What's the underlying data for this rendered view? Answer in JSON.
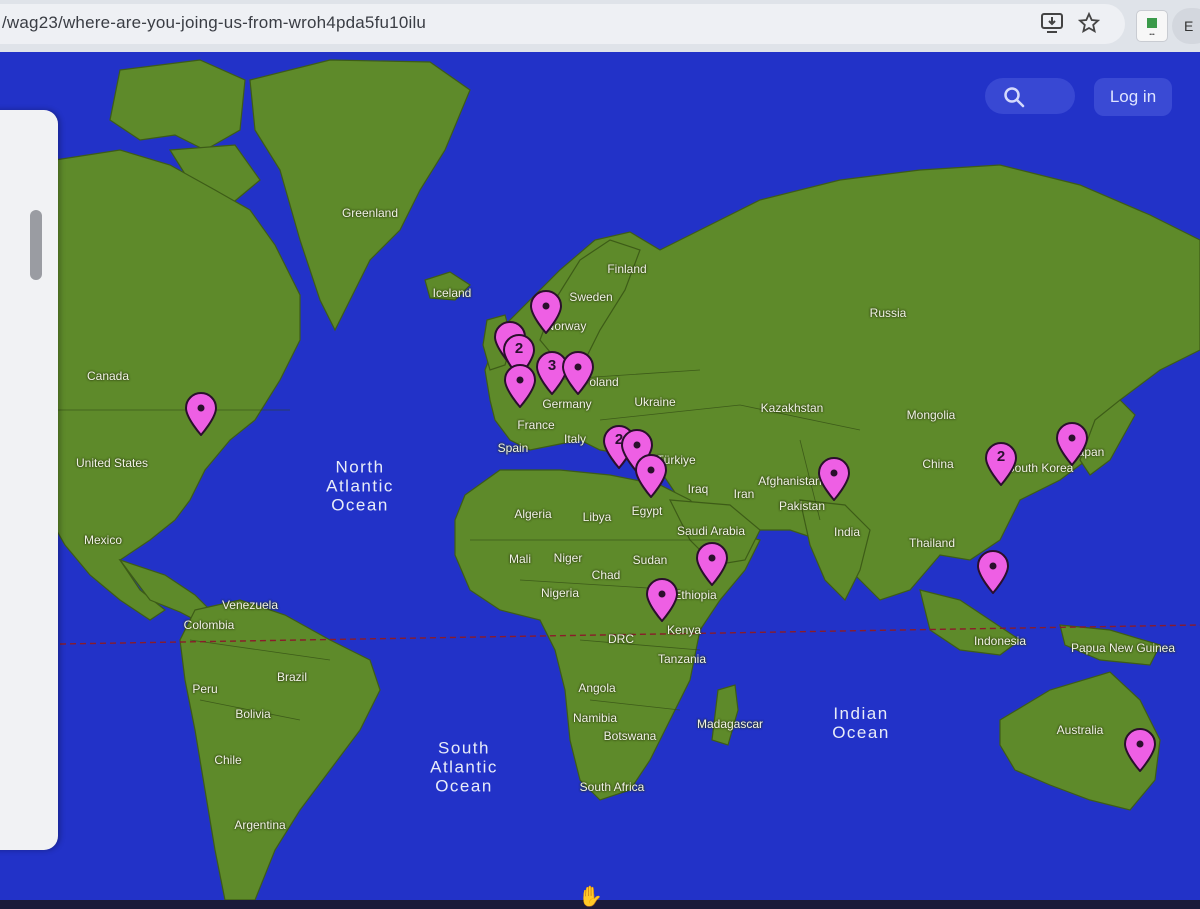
{
  "browser": {
    "url": "/wag23/where-are-you-joing-us-from-wroh4pda5fu10ilu",
    "profile_initial": "E"
  },
  "toolbar": {
    "search_icon": "search-icon",
    "login_label": "Log in"
  },
  "map": {
    "land_color": "#5e8a2a",
    "ocean_color": "#2232c8",
    "marker_color": "#ee5fe4",
    "countries": [
      "Greenland",
      "Iceland",
      "Finland",
      "Sweden",
      "Russia",
      "Canada",
      "United States",
      "Mexico",
      "Norway",
      "Poland",
      "Germany",
      "Ukraine",
      "France",
      "Italy",
      "Spain",
      "Kazakhstan",
      "Mongolia",
      "Türkiye",
      "Iraq",
      "Iran",
      "Afghanistan",
      "Pakistan",
      "China",
      "South Korea",
      "Japan",
      "Algeria",
      "Libya",
      "Egypt",
      "Saudi Arabia",
      "India",
      "Thailand",
      "Mali",
      "Niger",
      "Sudan",
      "Chad",
      "Nigeria",
      "Ethiopia",
      "Kenya",
      "DRC",
      "Tanzania",
      "Indonesia",
      "Papua New Guinea",
      "Venezuela",
      "Colombia",
      "Brazil",
      "Peru",
      "Bolivia",
      "Angola",
      "Namibia",
      "Botswana",
      "Madagascar",
      "Australia",
      "Chile",
      "Argentina",
      "South Africa"
    ],
    "oceans": [
      "North\nAtlantic\nOcean",
      "South\nAtlantic\nOcean",
      "Indian\nOcean"
    ],
    "marker_counts": [
      "",
      "2",
      "3",
      "2",
      "2"
    ]
  }
}
